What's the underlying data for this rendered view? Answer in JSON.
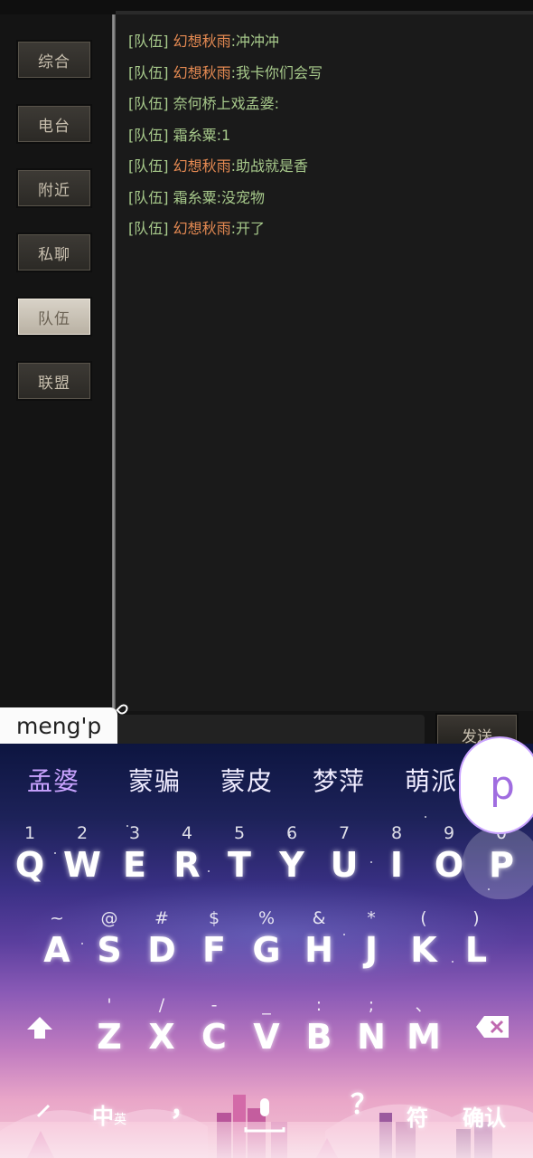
{
  "channels": [
    {
      "label": "综合",
      "active": false
    },
    {
      "label": "电台",
      "active": false
    },
    {
      "label": "附近",
      "active": false
    },
    {
      "label": "私聊",
      "active": false
    },
    {
      "label": "队伍",
      "active": true
    },
    {
      "label": "联盟",
      "active": false
    }
  ],
  "messages": [
    {
      "tag": "[队伍]",
      "sender": "幻想秋雨",
      "text": "冲冲冲"
    },
    {
      "tag": "[队伍]",
      "sender": "幻想秋雨",
      "text": "我卡你们会写"
    },
    {
      "tag": "[队伍]",
      "sender": "奈何桥上戏孟婆",
      "text": ""
    },
    {
      "tag": "[队伍]",
      "sender": "霜糸粟",
      "text": "1"
    },
    {
      "tag": "[队伍]",
      "sender": "幻想秋雨",
      "text": "助战就是香"
    },
    {
      "tag": "[队伍]",
      "sender": "霜糸粟",
      "text": "没宠物"
    },
    {
      "tag": "[队伍]",
      "sender": "幻想秋雨",
      "text": "开了"
    }
  ],
  "send_label": "发送",
  "composition": "meng'p",
  "candidates": [
    "孟婆",
    "蒙骗",
    "蒙皮",
    "梦萍",
    "萌派"
  ],
  "popup_key": "p",
  "keyboard": {
    "row1": [
      {
        "hint": "1",
        "key": "Q"
      },
      {
        "hint": "2",
        "key": "W"
      },
      {
        "hint": "3",
        "key": "E"
      },
      {
        "hint": "4",
        "key": "R"
      },
      {
        "hint": "5",
        "key": "T"
      },
      {
        "hint": "6",
        "key": "Y"
      },
      {
        "hint": "7",
        "key": "U"
      },
      {
        "hint": "8",
        "key": "I"
      },
      {
        "hint": "9",
        "key": "O"
      },
      {
        "hint": "0",
        "key": "P"
      }
    ],
    "row2": [
      {
        "hint": "~",
        "key": "A"
      },
      {
        "hint": "@",
        "key": "S"
      },
      {
        "hint": "#",
        "key": "D"
      },
      {
        "hint": "$",
        "key": "F"
      },
      {
        "hint": "%",
        "key": "G"
      },
      {
        "hint": "&",
        "key": "H"
      },
      {
        "hint": "*",
        "key": "J"
      },
      {
        "hint": "(",
        "key": "K"
      },
      {
        "hint": ")",
        "key": "L"
      }
    ],
    "row3": [
      {
        "hint": "'",
        "key": "Z"
      },
      {
        "hint": "/",
        "key": "X"
      },
      {
        "hint": "-",
        "key": "C"
      },
      {
        "hint": "_",
        "key": "V"
      },
      {
        "hint": ":",
        "key": "B"
      },
      {
        "hint": ";",
        "key": "N"
      },
      {
        "hint": "、",
        "key": "M"
      }
    ],
    "mode_label": "中",
    "mode_sub": "英",
    "comma_label": "，",
    "punct_label": "？",
    "symbols_label": "符",
    "confirm_label": "确认"
  }
}
